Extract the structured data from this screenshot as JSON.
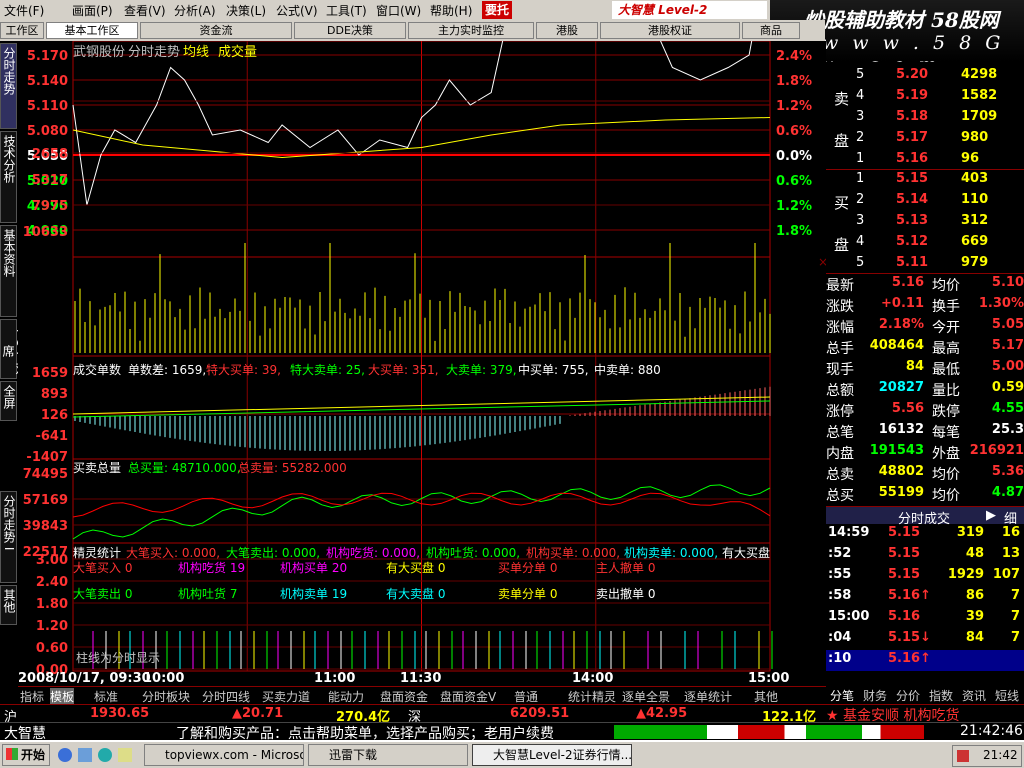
{
  "menu": [
    "文件(F)",
    "画面(P)",
    "查看(V)",
    "分析(A)",
    "决策(L)",
    "公式(V)",
    "工具(T)",
    "窗口(W)",
    "帮助(H)"
  ],
  "menu_hot": "要托",
  "brand": "大智慧 Level-2",
  "banner": {
    "line1": "炒股辅助教材 58股网",
    "line2": "w w w . 5 8 G u . c o m"
  },
  "tabs": [
    "工作区",
    "基本工作区",
    "资金流",
    "DDE决策",
    "主力实时监控",
    "港股",
    "港股权证",
    "商品"
  ],
  "side_tabs": [
    "分时走势",
    "技术分析",
    "基本资料",
    "T O P 双席",
    "全屏",
    "分时走势 I",
    "其他"
  ],
  "price_panel": {
    "stock": "武钢股份",
    "mode": "分时走势",
    "ma": "均线",
    "vol": "成交量",
    "yticks": [
      "5.170",
      "5.140",
      "5.110",
      "5.080",
      "5.050",
      "5.020",
      "4.990",
      "4.960"
    ],
    "pct": [
      "2.4%",
      "1.8%",
      "1.2%",
      "0.6%",
      "0.0%",
      "0.6%",
      "1.2%",
      "1.8%"
    ]
  },
  "volume_panel": {
    "yticks": [
      "10633",
      "7975",
      "5317",
      "2658"
    ]
  },
  "order_panel": {
    "title": "成交单数",
    "diff_label": "单数差: 1659,",
    "s1": "特大买单: 39,",
    "s2": "特大卖单: 25,",
    "s3": "大买单: 351,",
    "s4": "大卖单: 379,",
    "s5": "中买单: 755,",
    "s6": "中卖单: 880",
    "yticks": [
      "1659",
      "893",
      "126",
      "-641",
      "-1407"
    ]
  },
  "total_panel": {
    "title": "买卖总量",
    "buy": "总买量: 48710.000,",
    "sell": "总卖量: 55282.000",
    "yticks": [
      "74495",
      "57169",
      "39843",
      "22517"
    ]
  },
  "spirit_panel": {
    "title": "精灵统计",
    "items": [
      "大笔买入: 0.000,",
      "大笔卖出: 0.000,",
      "机构吃货: 0.000,",
      "机构吐货: 0.000,",
      "机构买单: 0.000,",
      "机构卖单: 0.000,",
      "有大买盘"
    ],
    "row1": [
      [
        "大笔买入",
        "0"
      ],
      [
        "机构吃货",
        "19"
      ],
      [
        "机构买单",
        "20"
      ],
      [
        "有大买盘",
        "0"
      ],
      [
        "买单分单",
        "0"
      ],
      [
        "主人撤单",
        "0"
      ]
    ],
    "row2": [
      [
        "大笔卖出",
        "0"
      ],
      [
        "机构吐货",
        "7"
      ],
      [
        "机构卖单",
        "19"
      ],
      [
        "有大卖盘",
        "0"
      ],
      [
        "卖单分单",
        "0"
      ],
      [
        "卖出撤单",
        "0"
      ]
    ],
    "yticks": [
      "3.00",
      "2.40",
      "1.80",
      "1.20",
      "0.60",
      "0.00"
    ],
    "note": "柱线为分时显示"
  },
  "xaxis": {
    "date": "2008/10/17, 09:30",
    "t": [
      "10:00",
      "11:00",
      "11:30",
      "14:00",
      "15:00"
    ]
  },
  "bottom_tabs": [
    "指标",
    "模板",
    "标准",
    "分时板块",
    "分时四线",
    "买卖力道",
    "能动力",
    "盘面资金",
    "盘面资金V",
    "普通",
    "统计精灵",
    "逐单全景",
    "逐单统计",
    "其他"
  ],
  "asks": [
    [
      "5",
      "5.20",
      "4298"
    ],
    [
      "4",
      "5.19",
      "1582"
    ],
    [
      "3",
      "5.18",
      "1709"
    ],
    [
      "2",
      "5.17",
      "980"
    ],
    [
      "1",
      "5.16",
      "96"
    ]
  ],
  "bids": [
    [
      "1",
      "5.15",
      "403"
    ],
    [
      "2",
      "5.14",
      "110"
    ],
    [
      "3",
      "5.13",
      "312"
    ],
    [
      "4",
      "5.12",
      "669"
    ],
    [
      "5",
      "5.11",
      "979"
    ]
  ],
  "ask_label": [
    "卖",
    "盘"
  ],
  "bid_label": [
    "买",
    "盘"
  ],
  "stats": [
    [
      "最新",
      "5.16",
      "均价",
      "5.10"
    ],
    [
      "涨跌",
      "+0.11",
      "换手",
      "1.30%"
    ],
    [
      "涨幅",
      "2.18%",
      "今开",
      "5.05"
    ],
    [
      "总手",
      "408464",
      "最高",
      "5.17"
    ],
    [
      "现手",
      "84",
      "最低",
      "5.00"
    ],
    [
      "总额",
      "20827",
      "量比",
      "0.59"
    ],
    [
      "涨停",
      "5.56",
      "跌停",
      "4.55"
    ],
    [
      "总笔",
      "16132",
      "每笔",
      "25.3"
    ],
    [
      "内盘",
      "191543",
      "外盘",
      "216921"
    ],
    [
      "总卖",
      "48802",
      "均价",
      "5.36"
    ],
    [
      "总买",
      "55199",
      "均价",
      "4.87"
    ]
  ],
  "ticks_header": "分时成交",
  "ticks_btn": "细",
  "ticks": [
    [
      "14:59",
      "5.15",
      "319",
      "16",
      ""
    ],
    [
      ":52",
      "5.15",
      "48",
      "13",
      ""
    ],
    [
      ":55",
      "5.15",
      "1929",
      "107",
      ""
    ],
    [
      ":58",
      "5.16",
      "86",
      "7",
      "↑"
    ],
    [
      "15:00",
      "5.16",
      "39",
      "7",
      ""
    ],
    [
      ":04",
      "5.15",
      "84",
      "7",
      "↓"
    ],
    [
      ":10",
      "5.16",
      "",
      "",
      "↑"
    ]
  ],
  "right_tabs": [
    "分笔",
    "财务",
    "分价",
    "指数",
    "资讯",
    "短线"
  ],
  "status1": {
    "market": "沪",
    "idx": "1930.65",
    "chg": "▲20.71",
    "amt": "270.4亿",
    "sz": "深",
    "szidx": "6209.51",
    "szchg": "▲42.95",
    "szamt": "122.1亿",
    "news": "★ 基金安顺 机构吃货"
  },
  "status2": {
    "brand": "大智慧",
    "msg": "了解和购买产品：点击帮助菜单，选择产品购买；老用户续费",
    "time": "21:42:46"
  },
  "taskbar": {
    "start": "开始",
    "items": [
      "topviewx.com - Microsof...",
      "迅雷下载",
      "大智慧Level-2证券行情..."
    ],
    "clock": "21:42"
  }
}
